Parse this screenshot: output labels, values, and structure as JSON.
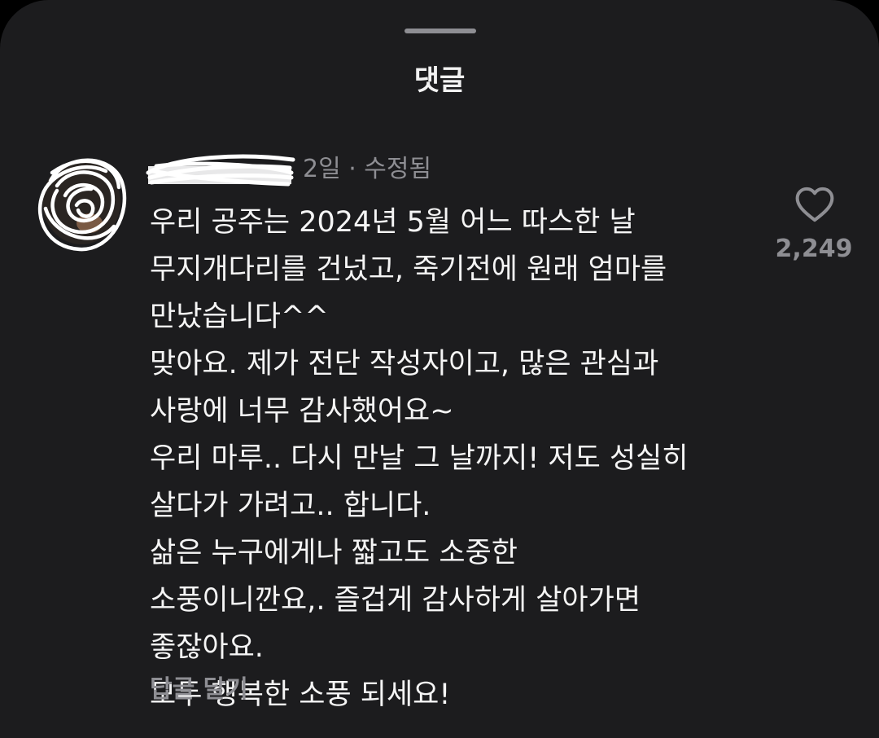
{
  "sheet": {
    "title": "댓글"
  },
  "comment": {
    "meta": "2일 · 수정됨",
    "lines": [
      "우리 공주는 2024년 5월 어느 따스한 날",
      "무지개다리를 건넜고, 죽기전에 원래 엄마를",
      "만났습니다^^",
      "맞아요. 제가 전단 작성자이고, 많은 관심과",
      "사랑에 너무 감사했어요~",
      "우리 마루.. 다시 만날 그 날까지! 저도 성실히",
      "살다가 가려고.. 합니다.",
      "삶은 누구에게나 짧고도 소중한",
      "소풍이니깐요,. 즐겁게 감사하게 살아가면",
      "좋잖아요.",
      "모두 행복한 소풍 되세요!"
    ],
    "reply_label": "답글 달기",
    "like_count": "2,249"
  },
  "icons": {
    "like": "heart-outline-icon",
    "avatar": "scribbled-avatar",
    "username": "scribbled-redaction"
  },
  "colors": {
    "background": "#1c1c1e",
    "text": "#f5f5f5",
    "secondary": "#8e8e93"
  }
}
